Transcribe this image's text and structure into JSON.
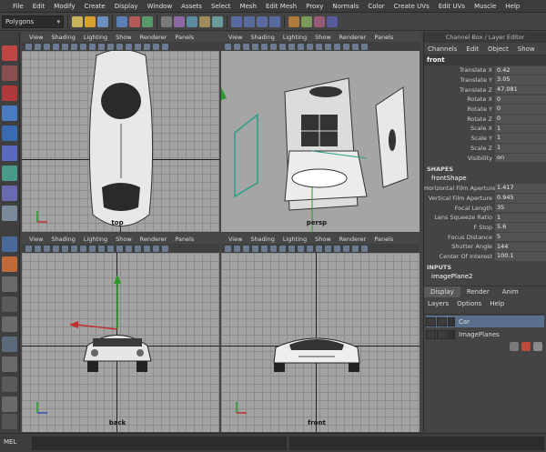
{
  "menubar": [
    "File",
    "Edit",
    "Modify",
    "Create",
    "Display",
    "Window",
    "Assets",
    "Select",
    "Mesh",
    "Edit Mesh",
    "Proxy",
    "Normals",
    "Color",
    "Create UVs",
    "Edit UVs",
    "Muscle",
    "Help"
  ],
  "toolbar": {
    "mode": "Polygons"
  },
  "viewport_menu": [
    "View",
    "Shading",
    "Lighting",
    "Show",
    "Renderer",
    "Panels"
  ],
  "viewports": {
    "top": "top",
    "persp": "persp",
    "back": "back",
    "front": "front"
  },
  "channel_box": {
    "title": "Channel Box / Layer Editor",
    "menu": [
      "Channels",
      "Edit",
      "Object",
      "Show"
    ],
    "object": "front",
    "transform": [
      {
        "label": "Translate X",
        "value": "0.42"
      },
      {
        "label": "Translate Y",
        "value": "3.05"
      },
      {
        "label": "Translate Z",
        "value": "47.081"
      },
      {
        "label": "Rotate X",
        "value": "0"
      },
      {
        "label": "Rotate Y",
        "value": "0"
      },
      {
        "label": "Rotate Z",
        "value": "0"
      },
      {
        "label": "Scale X",
        "value": "1"
      },
      {
        "label": "Scale Y",
        "value": "1"
      },
      {
        "label": "Scale Z",
        "value": "1"
      },
      {
        "label": "Visibility",
        "value": "on"
      }
    ],
    "shapes_label": "SHAPES",
    "shape_name": "frontShape",
    "shape_attrs": [
      {
        "label": "Horizontal Film Aperture",
        "value": "1.417"
      },
      {
        "label": "Vertical Film Aperture",
        "value": "0.945"
      },
      {
        "label": "Focal Length",
        "value": "35"
      },
      {
        "label": "Lens Squeeze Ratio",
        "value": "1"
      },
      {
        "label": "F Stop",
        "value": "5.6"
      },
      {
        "label": "Focus Distance",
        "value": "5"
      },
      {
        "label": "Shutter Angle",
        "value": "144"
      },
      {
        "label": "Center Of Interest",
        "value": "100.1"
      }
    ],
    "inputs_label": "INPUTS",
    "input_name": "imagePlane2"
  },
  "layer_editor": {
    "tabs": [
      "Display",
      "Render",
      "Anim"
    ],
    "menu": [
      "Layers",
      "Options",
      "Help"
    ],
    "layers": [
      "Car",
      "ImagePlanes"
    ]
  },
  "statusbar": {
    "mel": "MEL"
  }
}
